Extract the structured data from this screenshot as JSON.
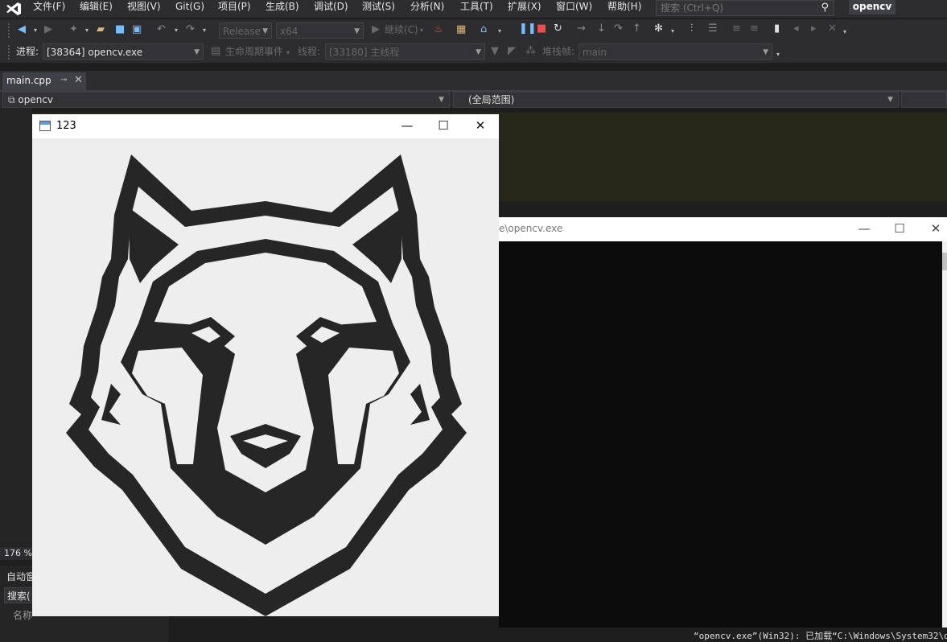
{
  "menubar": {
    "items": [
      "文件(F)",
      "编辑(E)",
      "视图(V)",
      "Git(G)",
      "项目(P)",
      "生成(B)",
      "调试(D)",
      "测试(S)",
      "分析(N)",
      "工具(T)",
      "扩展(X)",
      "窗口(W)",
      "帮助(H)"
    ],
    "search_placeholder": "搜索 (Ctrl+Q)",
    "solution_name": "opencv"
  },
  "toolbar": {
    "configuration": "Release",
    "platform": "x64",
    "continue_label": "继续(C)"
  },
  "debug_toolbar": {
    "process_label": "进程:",
    "process_value": "[38364] opencv.exe",
    "lifecycle_label": "生命周期事件",
    "thread_label": "线程:",
    "thread_value": "[33180] 主线程",
    "stack_label": "堆栈帧:",
    "stack_value": "main"
  },
  "editor": {
    "tab_label": "main.cpp",
    "project_scope": "opencv",
    "global_scope": "(全局范围)",
    "zoom_level": "176 %"
  },
  "bottom_panel": {
    "title": "自动窗",
    "search": "搜索(",
    "column_name": "名称"
  },
  "output": {
    "line": "“opencv.exe”(Win32): 已加载“C:\\Windows\\System32\\d"
  },
  "console_window": {
    "title": "e\\opencv.exe"
  },
  "image_window": {
    "title": "123"
  },
  "colors": {
    "ide_background": "#1e1e1e",
    "chrome": "#2d2d30",
    "accent_blue": "#75beff",
    "stop_red": "#f14c4c",
    "wolf_fill": "#262626"
  }
}
